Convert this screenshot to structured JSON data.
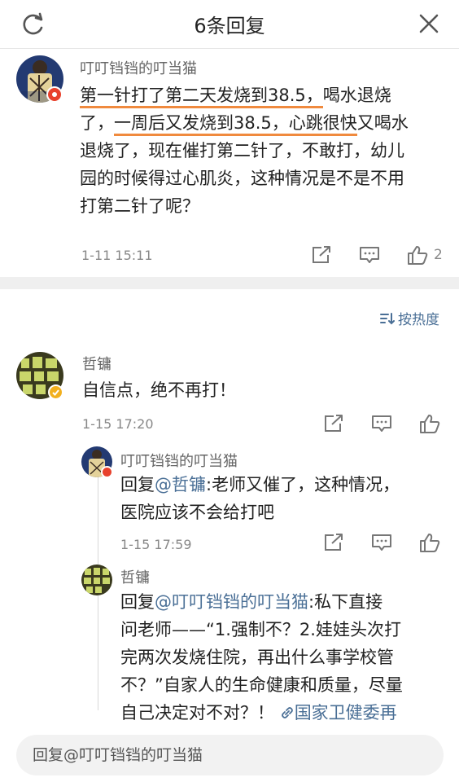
{
  "header": {
    "title": "6条回复"
  },
  "main_comment": {
    "author": "叮叮铛铛的叮当猫",
    "line1_a": "第一针打了第二天发烧到38.5，",
    "line1_b": "喝水退烧",
    "line2_a": "了，",
    "line2_b": "一周后又发烧到38.5，心跳很快",
    "line2_c": "又喝水",
    "line3": "退烧了，现在催打第二针了，不敢打，幼儿",
    "line4": "园的时候得过心肌炎，这种情况是不是不用",
    "line5": "打第二针了呢？",
    "time": "1-11 15:11",
    "likes": "2"
  },
  "sort_label": "按热度",
  "replies": [
    {
      "author": "哲镛",
      "text": "自信点，绝不再打！",
      "time": "1-15 17:20"
    }
  ],
  "sub_replies": [
    {
      "author": "叮叮铛铛的叮当猫",
      "prefix": "回复",
      "mention": "@哲镛",
      "line1_rest": ":老师又催了，这种情况，",
      "line2": "医院应该不会给打吧",
      "time": "1-15 17:59"
    },
    {
      "author": "哲镛",
      "prefix": "回复",
      "mention": "@叮叮铛铛的叮当猫",
      "line1_rest": ":私下直接",
      "line2": "问老师——“1.强制不？2.娃娃头次打",
      "line3": "完两次发烧住院，再出什么事学校管",
      "line4": "不？”自家人的生命健康和质量，尽量",
      "line5": "自己决定对不对？！",
      "link_text": "国家卫健委再"
    }
  ],
  "bottom": {
    "reply_placeholder": "回复@叮叮铛铛的叮当猫"
  },
  "colors": {
    "link": "#4a6f96",
    "underline": "#f08a3e",
    "badge_red": "#e8412c",
    "badge_gold": "#f2b01e"
  }
}
